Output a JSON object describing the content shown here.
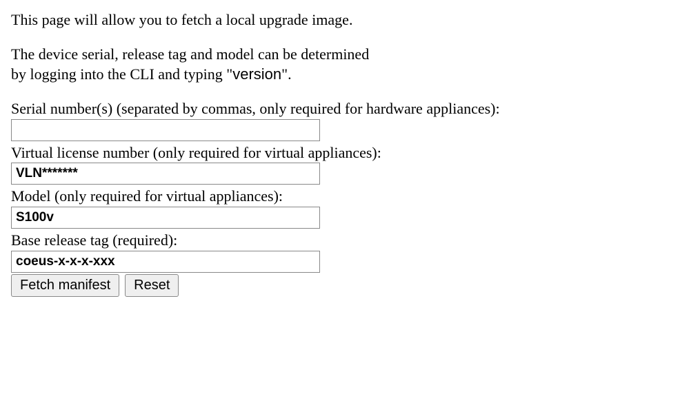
{
  "intro": "This page will allow you to fetch a local upgrade image.",
  "hint": {
    "line1": "The device serial, release tag and model can be determined",
    "line2_pre": "by logging into the CLI and typing \"",
    "cli_command": "version",
    "line2_post": "\"."
  },
  "fields": {
    "serial": {
      "label": "Serial number(s) (separated by commas, only required for hardware appliances):",
      "value": "",
      "placeholder": ""
    },
    "vln": {
      "label": "Virtual license number (only required for virtual appliances):",
      "value": "",
      "placeholder": "VLN*******"
    },
    "model": {
      "label": "Model (only required for virtual appliances):",
      "value": "",
      "placeholder": "S100v"
    },
    "release": {
      "label": "Base release tag (required):",
      "value": "",
      "placeholder": "coeus-x-x-x-xxx"
    }
  },
  "buttons": {
    "fetch": "Fetch manifest",
    "reset": "Reset"
  }
}
